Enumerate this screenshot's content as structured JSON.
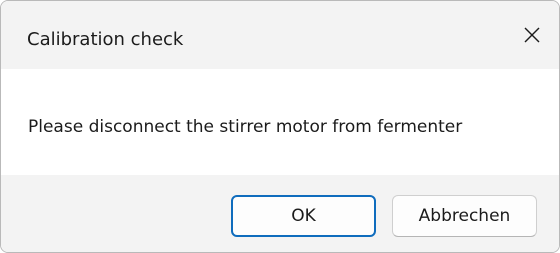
{
  "dialog": {
    "title": "Calibration check",
    "close_icon": "close-icon",
    "message": "Please disconnect the stirrer motor from fermenter",
    "buttons": {
      "ok_label": "OK",
      "cancel_label": "Abbrechen"
    },
    "colors": {
      "titlebar_background": "#f3f3f3",
      "content_background": "#ffffff",
      "footer_background": "#f3f3f3",
      "default_button_border": "#0f6cbd",
      "text": "#1b1b1b"
    }
  }
}
